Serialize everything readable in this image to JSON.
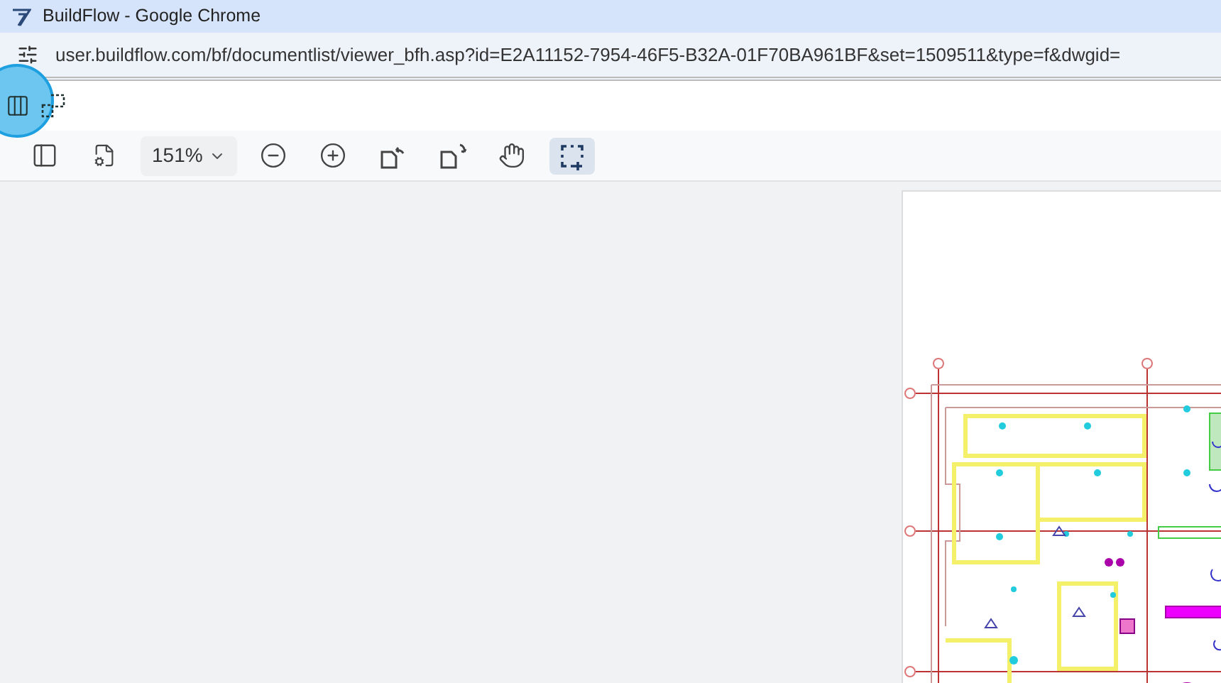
{
  "window": {
    "title": "BuildFlow - Google Chrome"
  },
  "address_bar": {
    "url": "user.buildflow.com/bf/documentlist/viewer_bfh.asp?id=E2A11152-7954-46F5-B32A-01F70BA961BF&set=1509511&type=f&dwgid="
  },
  "cursor_highlight": true,
  "toolbar": [
    {
      "kind": "sidebar",
      "selected": false
    },
    {
      "kind": "page-settings",
      "selected": false
    },
    {
      "kind": "zoom",
      "label": "151%",
      "selected": false
    },
    {
      "kind": "zoom-out",
      "selected": false
    },
    {
      "kind": "zoom-in",
      "selected": false
    },
    {
      "kind": "rotate-left",
      "selected": false
    },
    {
      "kind": "rotate-right",
      "selected": false
    },
    {
      "kind": "pan",
      "selected": false
    },
    {
      "kind": "marquee",
      "selected": true
    }
  ]
}
